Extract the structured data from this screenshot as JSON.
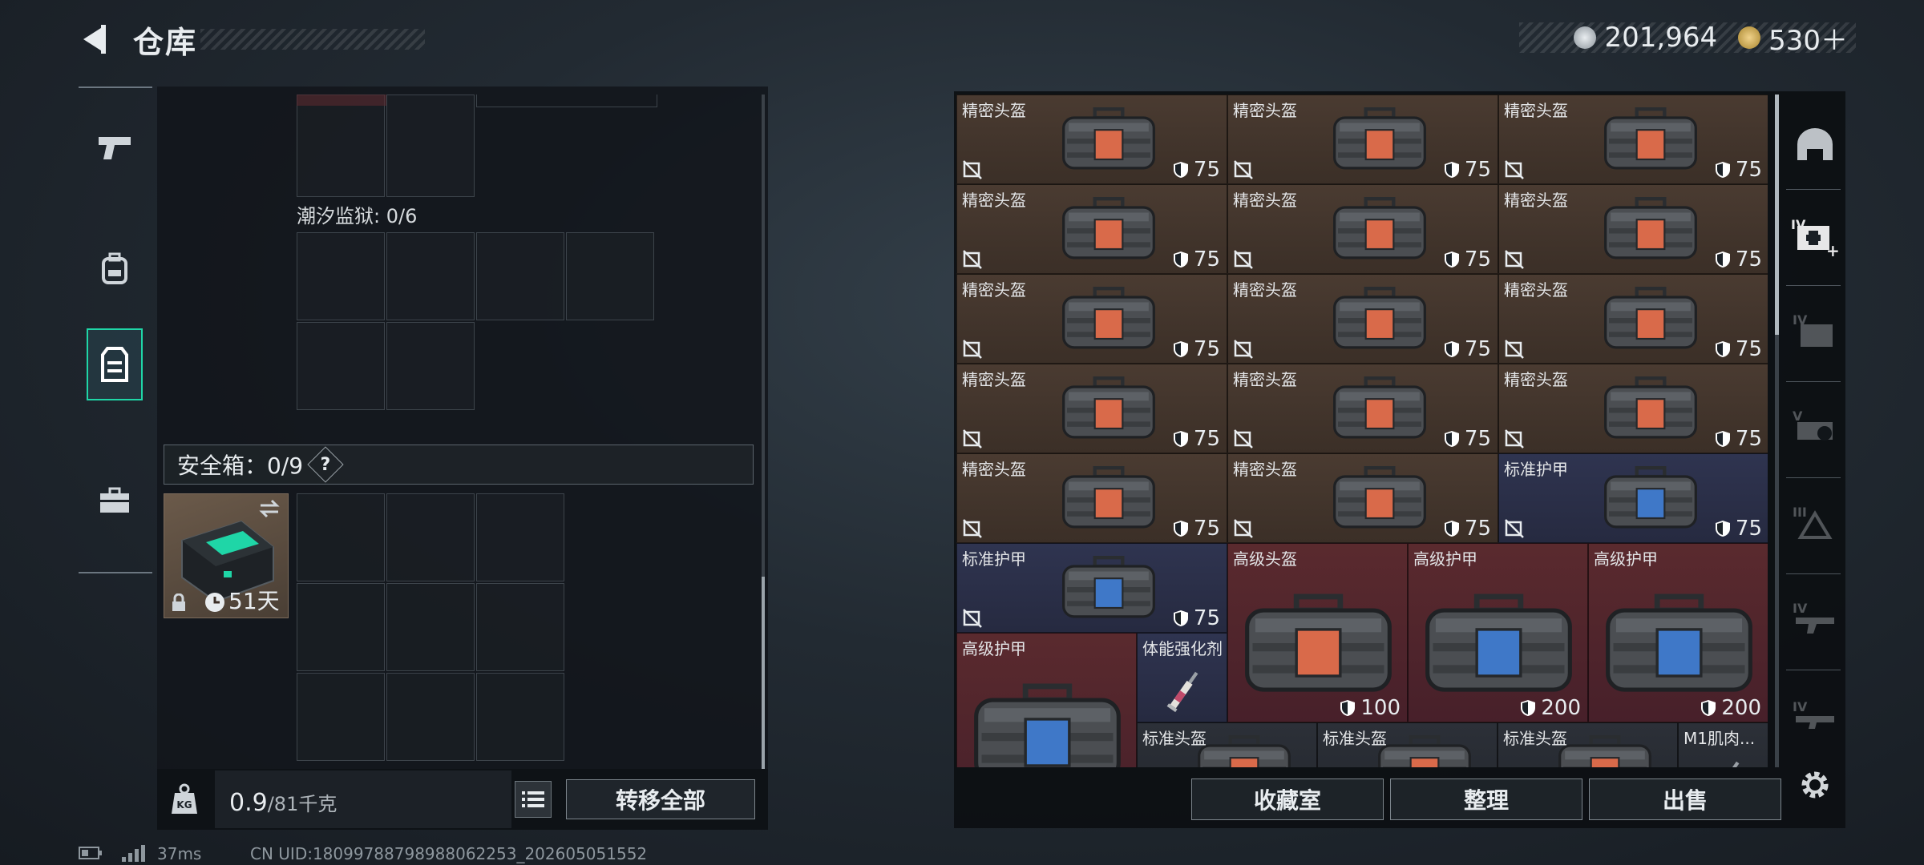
{
  "header": {
    "title": "仓库"
  },
  "currency": [
    {
      "icon": "silver-coin-icon",
      "value": "201,964"
    },
    {
      "icon": "gold-triangle-coin-icon",
      "value": "530＋"
    }
  ],
  "left_nav": [
    {
      "icon": "pistol-icon",
      "active": false
    },
    {
      "icon": "backpack-icon",
      "active": false
    },
    {
      "icon": "vest-icon",
      "active": true
    },
    {
      "icon": "briefcase-icon",
      "active": false
    }
  ],
  "container": {
    "label": "潮汐监狱: 0/6"
  },
  "secure_box": {
    "label": "安全箱：0/9",
    "help": "?",
    "timer": "51天"
  },
  "weight": {
    "current": "0.9",
    "max": "/81千克"
  },
  "buttons": {
    "transfer_all": "转移全部",
    "collection": "收藏室",
    "organize": "整理",
    "sell": "出售"
  },
  "status": {
    "ping": "37ms",
    "uid": "CN UID:18099788798988062253_202605051552"
  },
  "items": [
    {
      "name": "精密头盔",
      "value": "75",
      "color": "brown"
    },
    {
      "name": "精密头盔",
      "value": "75",
      "color": "brown"
    },
    {
      "name": "精密头盔",
      "value": "75",
      "color": "brown"
    },
    {
      "name": "精密头盔",
      "value": "75",
      "color": "brown"
    },
    {
      "name": "精密头盔",
      "value": "75",
      "color": "brown"
    },
    {
      "name": "精密头盔",
      "value": "75",
      "color": "brown"
    },
    {
      "name": "精密头盔",
      "value": "75",
      "color": "brown"
    },
    {
      "name": "精密头盔",
      "value": "75",
      "color": "brown"
    },
    {
      "name": "精密头盔",
      "value": "75",
      "color": "brown"
    },
    {
      "name": "精密头盔",
      "value": "75",
      "color": "brown"
    },
    {
      "name": "精密头盔",
      "value": "75",
      "color": "brown"
    },
    {
      "name": "精密头盔",
      "value": "75",
      "color": "brown"
    },
    {
      "name": "精密头盔",
      "value": "75",
      "color": "brown"
    },
    {
      "name": "精密头盔",
      "value": "75",
      "color": "brown"
    },
    {
      "name": "标准护甲",
      "value": "75",
      "color": "navy"
    },
    {
      "name": "标准护甲",
      "value": "75",
      "color": "navy"
    },
    {
      "name": "高级头盔",
      "value": "100",
      "color": "red"
    },
    {
      "name": "高级护甲",
      "value": "200",
      "color": "red"
    },
    {
      "name": "高级护甲",
      "value": "200",
      "color": "red"
    },
    {
      "name": "高级护甲",
      "value": "",
      "color": "red"
    },
    {
      "name": "体能强化剂",
      "value": "",
      "color": "navy"
    },
    {
      "name": "标准头盔",
      "value": "",
      "color": "gray"
    },
    {
      "name": "标准头盔",
      "value": "",
      "color": "gray"
    },
    {
      "name": "标准头盔",
      "value": "",
      "color": "gray"
    },
    {
      "name": "M1肌肉...",
      "value": "",
      "color": "gray"
    }
  ],
  "side_icons": [
    {
      "icon": "helmet-slot-icon"
    },
    {
      "icon": "medkit-iv-icon"
    },
    {
      "icon": "ammo-iv-icon"
    },
    {
      "icon": "scope-v-icon"
    },
    {
      "icon": "armor-iii-icon"
    },
    {
      "icon": "gun-iv-icon"
    },
    {
      "icon": "gun-iv-2-icon"
    },
    {
      "icon": "settings-gear-icon"
    }
  ],
  "colors": {
    "accent": "#1fd6a7",
    "helmet_bg": "#4a3b31",
    "armor_bg": "#2f3450",
    "rare_bg": "#5a2a2e"
  }
}
